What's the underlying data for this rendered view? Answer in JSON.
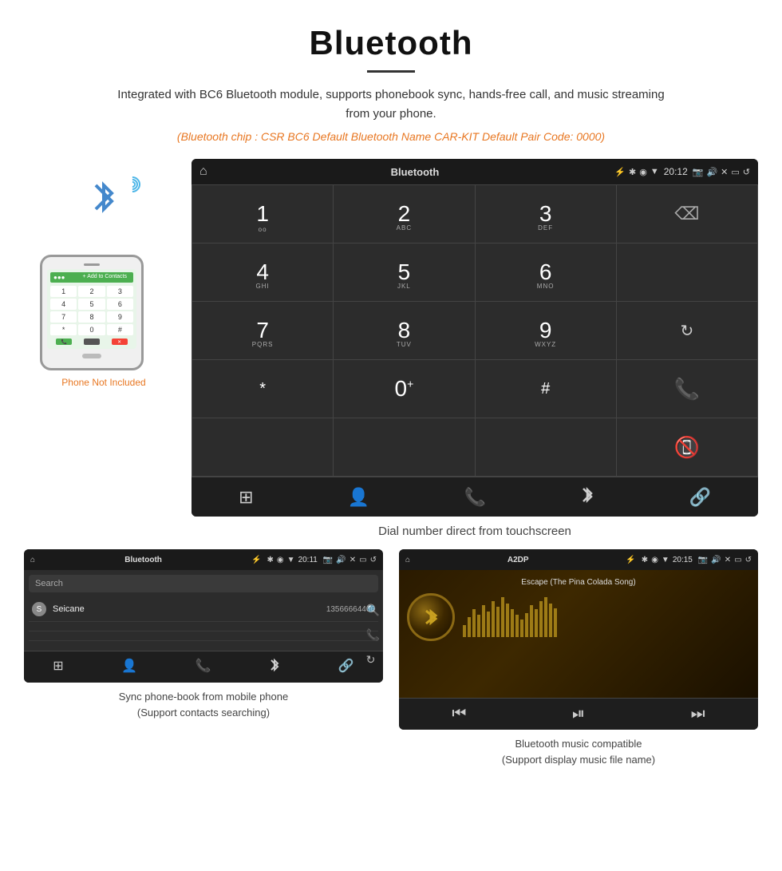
{
  "page": {
    "title": "Bluetooth",
    "divider": true,
    "subtitle": "Integrated with BC6 Bluetooth module, supports phonebook sync, hands-free call, and music streaming from your phone.",
    "specs": "(Bluetooth chip : CSR BC6    Default Bluetooth Name CAR-KIT    Default Pair Code: 0000)"
  },
  "phone_label": "Phone Not Included",
  "dial_screen": {
    "status_bar": {
      "home_icon": "⌂",
      "title": "Bluetooth",
      "usb_icon": "⚡",
      "bt_icon": "✱",
      "location_icon": "◉",
      "signal_icon": "▼",
      "time": "20:12",
      "camera_icon": "📷",
      "volume_icon": "🔊",
      "close_icon": "✕",
      "window_icon": "▭",
      "back_icon": "↺"
    },
    "keys": [
      {
        "main": "1",
        "sub": ""
      },
      {
        "main": "2",
        "sub": "ABC"
      },
      {
        "main": "3",
        "sub": "DEF"
      },
      {
        "main": "backspace",
        "sub": ""
      },
      {
        "main": "4",
        "sub": "GHI"
      },
      {
        "main": "5",
        "sub": "JKL"
      },
      {
        "main": "6",
        "sub": "MNO"
      },
      {
        "main": "",
        "sub": ""
      },
      {
        "main": "7",
        "sub": "PQRS"
      },
      {
        "main": "8",
        "sub": "TUV"
      },
      {
        "main": "9",
        "sub": "WXYZ"
      },
      {
        "main": "refresh",
        "sub": ""
      },
      {
        "main": "*",
        "sub": ""
      },
      {
        "main": "0+",
        "sub": ""
      },
      {
        "main": "#",
        "sub": ""
      },
      {
        "main": "call_green",
        "sub": ""
      },
      {
        "main": "call_red",
        "sub": ""
      }
    ],
    "toolbar": {
      "grid_icon": "⊞",
      "person_icon": "👤",
      "phone_icon": "📞",
      "bt_icon": "✱",
      "link_icon": "🔗"
    }
  },
  "dial_caption": "Dial number direct from touchscreen",
  "phonebook_screen": {
    "status_bar": {
      "home_icon": "⌂",
      "title": "Bluetooth",
      "usb_icon": "⚡",
      "bt_icon": "✱",
      "location_icon": "◉",
      "signal_icon": "▼",
      "time": "20:11",
      "camera_icon": "📷",
      "volume_icon": "🔊",
      "close_icon": "✕",
      "window_icon": "▭",
      "back_icon": "↺"
    },
    "search_placeholder": "Search",
    "contacts": [
      {
        "letter": "S",
        "name": "Seicane",
        "number": "13566664466"
      }
    ],
    "toolbar": {
      "grid_icon": "⊞",
      "person_icon": "👤",
      "phone_icon": "📞",
      "bt_icon": "✱",
      "link_icon": "🔗"
    }
  },
  "phonebook_caption": "Sync phone-book from mobile phone\n(Support contacts searching)",
  "music_screen": {
    "status_bar": {
      "home_icon": "⌂",
      "title": "A2DP",
      "usb_icon": "⚡",
      "bt_icon": "✱",
      "location_icon": "◉",
      "signal_icon": "▼",
      "time": "20:15",
      "camera_icon": "📷",
      "volume_icon": "🔊",
      "close_icon": "✕",
      "window_icon": "▭",
      "back_icon": "↺"
    },
    "song_title": "Escape (The Pina Colada Song)",
    "album_icon": "🎵",
    "toolbar": {
      "prev_icon": "⏮",
      "play_pause_icon": "⏯",
      "next_icon": "⏭"
    },
    "bars": [
      15,
      25,
      35,
      28,
      40,
      32,
      45,
      38,
      50,
      42,
      35,
      28,
      22,
      30,
      40,
      35,
      45,
      50,
      42,
      36
    ]
  },
  "music_caption": "Bluetooth music compatible\n(Support display music file name)"
}
